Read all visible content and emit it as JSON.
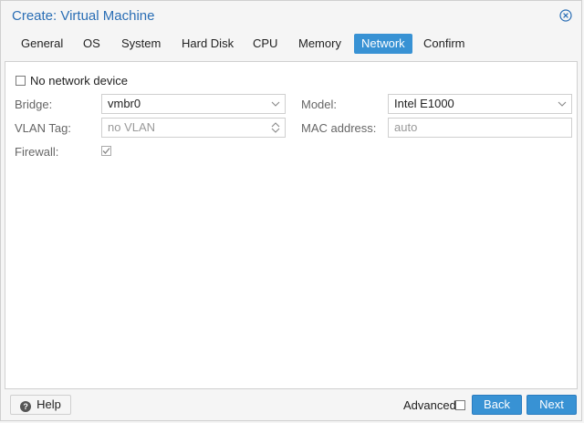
{
  "window": {
    "title": "Create: Virtual Machine"
  },
  "tabs": [
    {
      "label": "General"
    },
    {
      "label": "OS"
    },
    {
      "label": "System"
    },
    {
      "label": "Hard Disk"
    },
    {
      "label": "CPU"
    },
    {
      "label": "Memory"
    },
    {
      "label": "Network",
      "active": true
    },
    {
      "label": "Confirm"
    }
  ],
  "form": {
    "no_network_label": "No network device",
    "no_network_checked": false,
    "bridge_label": "Bridge:",
    "bridge_value": "vmbr0",
    "model_label": "Model:",
    "model_value": "Intel E1000",
    "vlan_label": "VLAN Tag:",
    "vlan_placeholder": "no VLAN",
    "mac_label": "MAC address:",
    "mac_placeholder": "auto",
    "firewall_label": "Firewall:",
    "firewall_checked": true
  },
  "footer": {
    "help_label": "Help",
    "advanced_label": "Advanced",
    "advanced_checked": false,
    "back_label": "Back",
    "next_label": "Next"
  },
  "colors": {
    "accent": "#3892d4",
    "title": "#2a6eb5"
  },
  "icons": {
    "close": "close-circle-icon",
    "dropdown": "chevron-down-icon",
    "spinner": "spinner-arrows-icon",
    "help": "question-circle-icon",
    "check": "checkmark-icon"
  }
}
